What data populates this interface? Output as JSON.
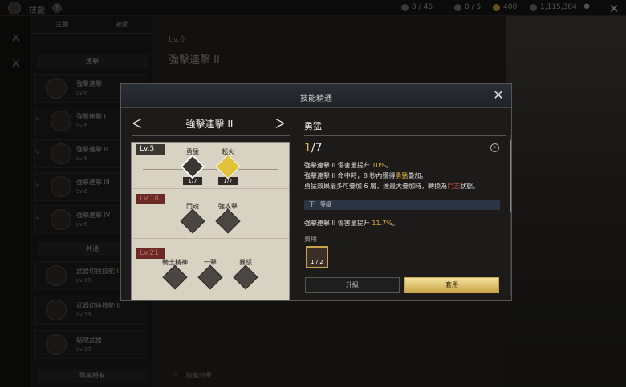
{
  "topbar": {
    "title": "技能",
    "res1": "0 / 46",
    "res2": "0 / 5",
    "res3": "400",
    "res4": "1,115,304"
  },
  "sidebar": {
    "tab_left": "主動",
    "tab_right": "被動",
    "category_top": "連擊",
    "category_mid": "共通",
    "category_bottom": "職業特有",
    "skills": [
      {
        "name": "強擊連擊",
        "level": "Lv.6"
      },
      {
        "name": "強擊連擊 I",
        "level": "Lv.6"
      },
      {
        "name": "強擊連擊 II",
        "level": "Lv.6"
      },
      {
        "name": "強擊連擊 III",
        "level": "Lv.6"
      },
      {
        "name": "強擊連擊 IV",
        "level": "Lv.6"
      },
      {
        "name": "武器切換技能 I",
        "level": "Lv.19"
      },
      {
        "name": "武器切換技能 II",
        "level": "Lv.19"
      },
      {
        "name": "黏燃武器",
        "level": "Lv.19"
      }
    ]
  },
  "background": {
    "level": "Lv.6",
    "title": "強擊連擊 II",
    "search": "技能效果"
  },
  "modal": {
    "title": "技能精通",
    "skill_name": "強擊連擊 II",
    "tree": {
      "rows": [
        {
          "level": "Lv.5",
          "nodes": [
            {
              "label": "勇猛",
              "count": "1/7"
            },
            {
              "label": "起火",
              "count": "1/7"
            }
          ]
        },
        {
          "level": "Lv.18",
          "nodes": [
            {
              "label": "鬥魂"
            },
            {
              "label": "強攻擊"
            }
          ]
        },
        {
          "level": "Lv.21",
          "nodes": [
            {
              "label": "騎士精神"
            },
            {
              "label": "一擊"
            },
            {
              "label": "暴怒"
            }
          ]
        }
      ]
    },
    "detail": {
      "name": "勇猛",
      "current": "1",
      "max": "/7",
      "desc1_a": "強擊連擊 II 傷害量提升 ",
      "desc1_b": "10%",
      "desc1_c": "。",
      "desc2_a": "強擊連擊 II 命中時，8 秒內獲得",
      "desc2_b": "勇猛",
      "desc2_c": "疊加。",
      "desc3_a": "勇猛效果最多可疊加 6 層，達最大疊加時，轉換為",
      "desc3_b": "鬥志",
      "desc3_c": "狀態。",
      "next_label": "下一等級",
      "next_a": "強擊連擊 II 傷害量提升 ",
      "next_b": "11.7%",
      "next_c": "。",
      "cost_label": "費用",
      "cost_qty": "1 / 2",
      "btn_upgrade": "升級",
      "btn_apply": "套用"
    }
  },
  "colors": {
    "gold": "#e0b640",
    "locked": "#6b2a25",
    "panel": "#1c1b1a"
  }
}
